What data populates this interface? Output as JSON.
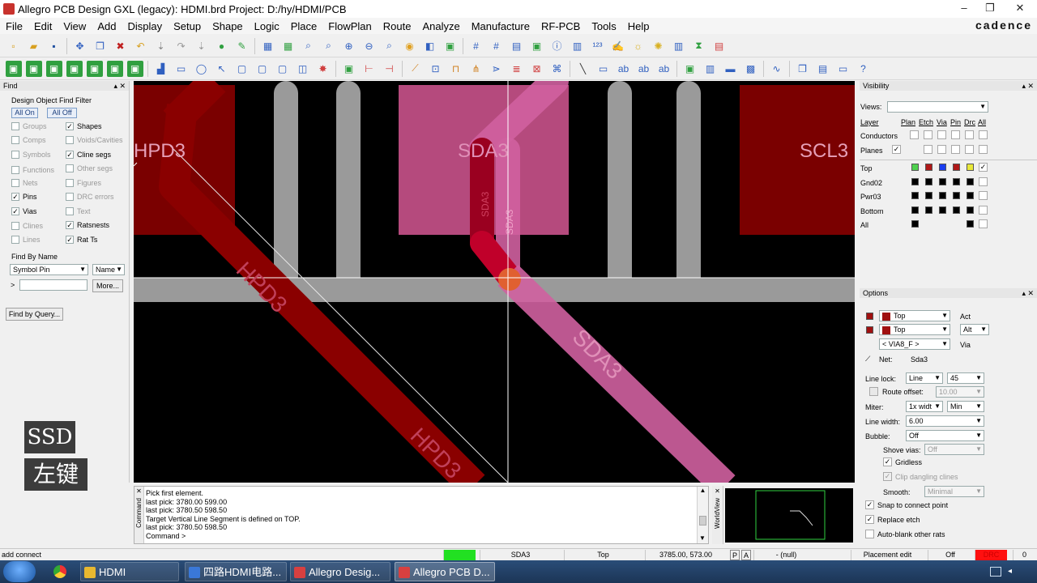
{
  "window": {
    "title": "Allegro PCB Design GXL (legacy): HDMI.brd  Project: D:/hy/HDMI/PCB",
    "controls": [
      "–",
      "❐",
      "✕"
    ]
  },
  "menu": {
    "items": [
      "File",
      "Edit",
      "View",
      "Add",
      "Display",
      "Setup",
      "Shape",
      "Logic",
      "Place",
      "FlowPlan",
      "Route",
      "Analyze",
      "Manufacture",
      "RF-PCB",
      "Tools",
      "Help"
    ],
    "brand": "cadence"
  },
  "find": {
    "header": "Find",
    "group_title": "Design Object Find Filter",
    "all_on": "All On",
    "all_off": "All Off",
    "filters_left": [
      {
        "label": "Groups",
        "checked": false
      },
      {
        "label": "Comps",
        "checked": false
      },
      {
        "label": "Symbols",
        "checked": false
      },
      {
        "label": "Functions",
        "checked": false
      },
      {
        "label": "Nets",
        "checked": false
      },
      {
        "label": "Pins",
        "checked": true
      },
      {
        "label": "Vias",
        "checked": true
      },
      {
        "label": "Clines",
        "checked": false
      },
      {
        "label": "Lines",
        "checked": false
      }
    ],
    "filters_right": [
      {
        "label": "Shapes",
        "checked": true
      },
      {
        "label": "Voids/Cavities",
        "checked": false
      },
      {
        "label": "Cline segs",
        "checked": true
      },
      {
        "label": "Other segs",
        "checked": false
      },
      {
        "label": "Figures",
        "checked": false
      },
      {
        "label": "DRC errors",
        "checked": false
      },
      {
        "label": "Text",
        "checked": false
      },
      {
        "label": "Ratsnests",
        "checked": true
      },
      {
        "label": "Rat Ts",
        "checked": true
      }
    ],
    "find_by_name": "Find By Name",
    "name_type": "Symbol Pin",
    "name_mode": "Name",
    "more": "More...",
    "prompt_arrow": ">",
    "find_by_query": "Find by Query..."
  },
  "canvas": {
    "labels": {
      "hpd3_top": "HPD3",
      "sda3_top": "SDA3",
      "scl3": "SCL3",
      "sda3_vert_a": "SDA3",
      "sda3_vert_b": "SDA3",
      "hpd3_diag": "HPD3",
      "sda3_diag": "SDA3",
      "hpd3_bottom": "HPD3"
    },
    "colors": {
      "background": "#000000",
      "dark_red": "#8b0000",
      "pink": "#c0508a",
      "grey": "#9a9a9a"
    }
  },
  "overlay": {
    "ssd": "SSD",
    "left_click": "左键"
  },
  "command": {
    "side_label": "Command",
    "lines": [
      "Pick first element.",
      "last pick:  3780.00 599.00",
      "last pick:  3780.50 598.50",
      "Target Vertical Line Segment is defined on TOP.",
      "last pick:  3780.50 598.50",
      "Command >"
    ],
    "worldview_label": "WorldView"
  },
  "visibility": {
    "header": "Visibility",
    "views_label": "Views:",
    "columns": [
      "Layer",
      "Plan",
      "Etch",
      "Via",
      "Pin",
      "Drc",
      "All"
    ],
    "conductors": "Conductors",
    "planes": "Planes",
    "layers": [
      {
        "name": "Top",
        "colors": [
          "#4fd14f",
          "#b01818",
          "#1a3df0",
          "#b01818",
          "#e8e83a"
        ],
        "all": true
      },
      {
        "name": "Gnd02",
        "colors": [
          "#000000",
          "#000000",
          "#000000",
          "#000000",
          "#000000"
        ],
        "all": false
      },
      {
        "name": "Pwr03",
        "colors": [
          "#000000",
          "#000000",
          "#000000",
          "#000000",
          "#000000"
        ],
        "all": false
      },
      {
        "name": "Bottom",
        "colors": [
          "#000000",
          "#000000",
          "#000000",
          "#000000",
          "#000000"
        ],
        "all": false
      },
      {
        "name": "All",
        "colors": [
          "#000000",
          "",
          "",
          "",
          "#000000"
        ],
        "all": false
      }
    ]
  },
  "options": {
    "header": "Options",
    "act_layer": "Top",
    "act_label": "Act",
    "alt_layer": "Top",
    "alt_label": "Alt",
    "via": "< VIA8_F >",
    "via_label": "Via",
    "net_label": "Net:",
    "net_value": "Sda3",
    "line_lock_label": "Line lock:",
    "line_lock_value": "Line",
    "line_lock_angle": "45",
    "route_offset_label": "Route offset:",
    "route_offset_value": "10.00",
    "miter_label": "Miter:",
    "miter_value": "1x widt",
    "miter_mode": "Min",
    "line_width_label": "Line width:",
    "line_width_value": "6.00",
    "bubble_label": "Bubble:",
    "bubble_value": "Off",
    "shove_vias_label": "Shove vias:",
    "shove_vias_value": "Off",
    "gridless": "Gridless",
    "clip_dangling": "Clip dangling clines",
    "smooth_label": "Smooth:",
    "smooth_value": "Minimal",
    "snap": "Snap to connect point",
    "replace_etch": "Replace etch",
    "auto_blank": "Auto-blank other rats"
  },
  "status": {
    "command": "add connect",
    "net": "SDA3",
    "layer": "Top",
    "coords": "3785.00, 573.00",
    "p": "P",
    "a": "A",
    "null": "- (null)",
    "mode": "Placement edit",
    "off": "Off",
    "drc": "DRC",
    "count": "0"
  },
  "taskbar": {
    "items": [
      "HDMI",
      "四路HDMI电路...",
      "Allegro Desig...",
      "Allegro PCB D..."
    ]
  }
}
